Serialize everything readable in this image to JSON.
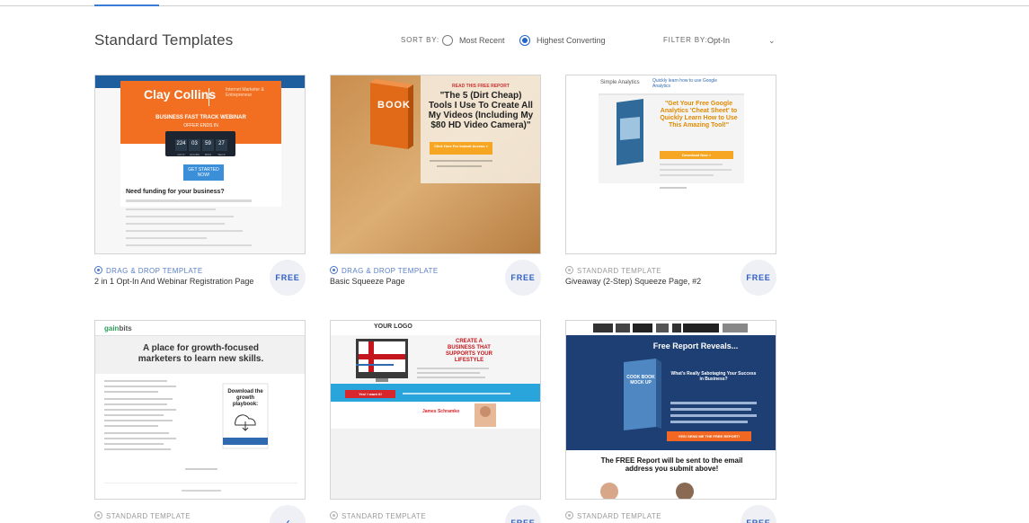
{
  "header": {
    "title": "Standard Templates",
    "sort_by_label": "SORT BY:",
    "sort_options": [
      "Most Recent",
      "Highest Converting"
    ],
    "sort_selected": "Highest Converting",
    "filter_by_label": "FILTER BY:",
    "filter_value": "Opt-In",
    "filter_chevron": "⌄"
  },
  "templates": [
    {
      "type": "DRAG & DROP TEMPLATE",
      "name": "2 in 1 Opt-In And Webinar Registration Page",
      "badge": "FREE",
      "preview": {
        "brand": "Clay Collins",
        "brand_sub": "Internet Marketer & Entrepreneur",
        "headline": "BUSINESS FAST TRACK WEBINAR",
        "subhead": "OFFER ENDS IN",
        "countdown": [
          "224",
          "03",
          "59",
          "27"
        ],
        "countdown_labels": [
          "DAYS",
          "HOURS",
          "MINS",
          "SECS"
        ],
        "cta": "GET STARTED NOW!",
        "body_heading": "Need funding for your business?"
      }
    },
    {
      "type": "DRAG & DROP TEMPLATE",
      "name": "Basic Squeeze Page",
      "badge": "FREE",
      "preview": {
        "book": "BOOK",
        "kicker": "READ THIS FREE REPORT",
        "headline": "\"The 5 (Dirt Cheap) Tools I Use To Create All My Videos (Including My $80 HD Video Camera)\"",
        "cta": "Click Here For Instant Access »"
      }
    },
    {
      "type": "STANDARD TEMPLATE",
      "name": "Giveaway (2-Step) Squeeze Page, #2",
      "badge": "FREE",
      "preview": {
        "brand": "Simple Analytics",
        "top_line": "Quickly learn how to use Google Analytics",
        "headline": "\"Get Your Free Google Analytics 'Cheat Sheet' to Quickly Learn How to Use This Amazing Tool!\"",
        "cta": "Download Now »"
      }
    },
    {
      "type": "STANDARD TEMPLATE",
      "name": "",
      "badge": "✓",
      "preview": {
        "brand_a": "gain",
        "brand_b": "bits",
        "headline": "A place for growth-focused marketers to learn new skills.",
        "side_heading": "Download the growth playbook:"
      }
    },
    {
      "type": "STANDARD TEMPLATE",
      "name": "",
      "badge": "FREE",
      "preview": {
        "logo": "YOUR LOGO",
        "headline": "CREATE A BUSINESS THAT SUPPORTS YOUR LIFESTYLE",
        "cta": "Yes! I want it!",
        "person": "James Schramko"
      }
    },
    {
      "type": "STANDARD TEMPLATE",
      "name": "",
      "badge": "FREE",
      "preview": {
        "headline": "Free Report Reveals...",
        "subhead": "What's Really Sabotaging Your Success in Business?",
        "book": "COOK BOOK MOCK UP",
        "cta": "YES! SEND ME THE FREE REPORT!",
        "bottom": "The FREE Report will be sent to the email address you submit above!"
      }
    }
  ],
  "colors": {
    "accent": "#2563c9",
    "badge_text": "#2f5ec4",
    "badge_bg": "#eef0f5",
    "card_border": "#d4d4d4"
  }
}
